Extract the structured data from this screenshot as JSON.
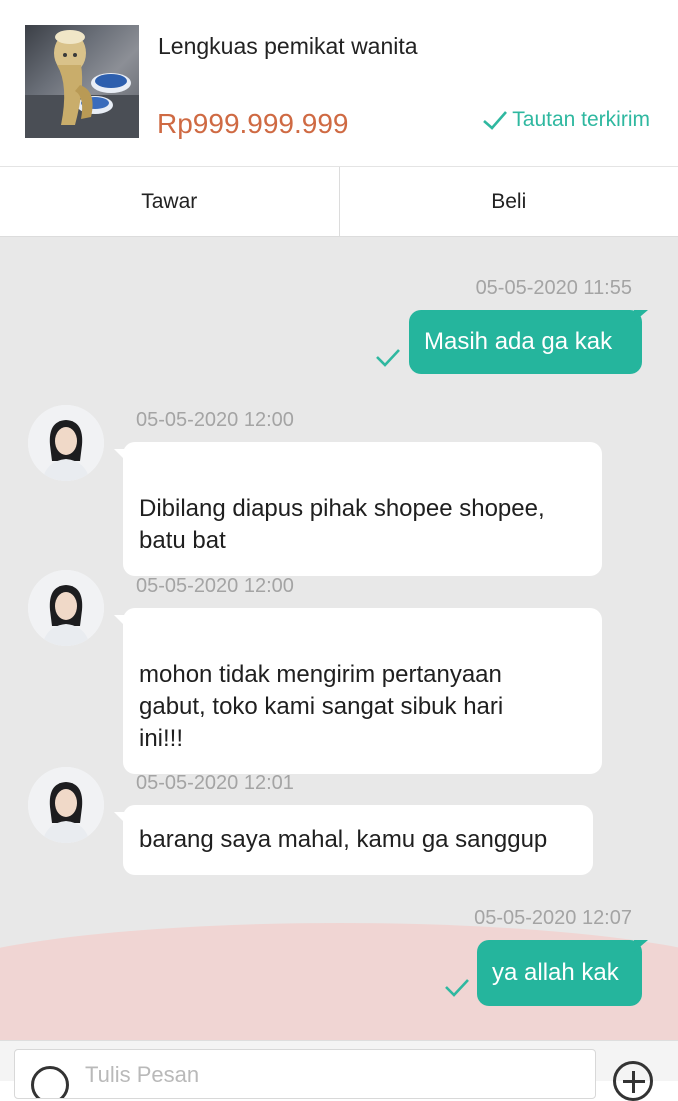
{
  "product": {
    "name": "Lengkuas pemikat wanita",
    "price": "Rp999.999.999",
    "link_status": "Tautan terkirim",
    "thumbnail_icon": "product-photo"
  },
  "actions": {
    "offer_label": "Tawar",
    "buy_label": "Beli"
  },
  "messages": [
    {
      "direction": "out",
      "timestamp": "05-05-2020 11:55",
      "text": "Masih ada ga kak",
      "status": "sent"
    },
    {
      "direction": "in",
      "timestamp": "05-05-2020 12:00",
      "text": "Dibilang diapus pihak shopee shopee,\nbatu bat"
    },
    {
      "direction": "in",
      "timestamp": "05-05-2020 12:00",
      "text": "mohon tidak mengirim pertanyaan\ngabut, toko kami sangat sibuk hari\nini!!!"
    },
    {
      "direction": "in",
      "timestamp": "05-05-2020 12:01",
      "text": "barang saya mahal, kamu ga sanggup"
    },
    {
      "direction": "out",
      "timestamp": "05-05-2020 12:07",
      "text": "ya allah kak",
      "status": "sent"
    }
  ],
  "composer": {
    "placeholder": "Tulis Pesan"
  },
  "colors": {
    "accent": "#25b59d",
    "price": "#cf6a43",
    "chat_background": "#e8e8e8",
    "incoming_bubble": "#ffffff"
  }
}
